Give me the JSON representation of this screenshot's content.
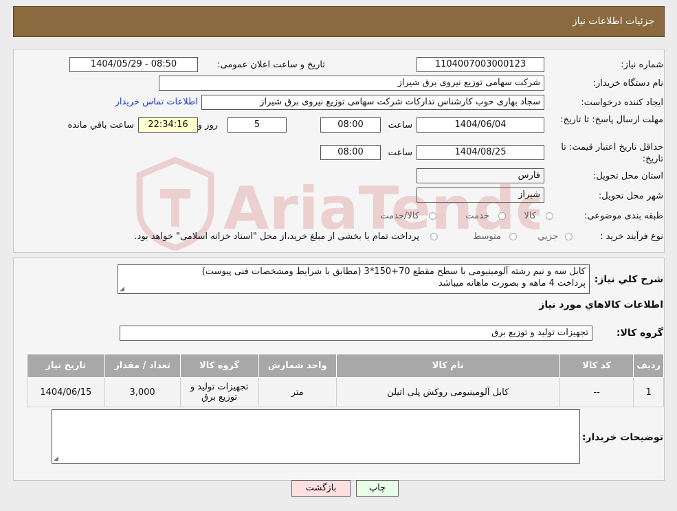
{
  "header": {
    "title": "جزئیات اطلاعات نیاز"
  },
  "form": {
    "need_number_label": "شماره نیاز:",
    "need_number": "1104007003000123",
    "announce_label": "تاریخ و ساعت اعلان عمومی:",
    "announce_value": "1404/05/29 - 08:50",
    "buyer_label": "نام دستگاه خریدار:",
    "buyer_value": "شرکت سهامی توزیع نیروی برق شیراز",
    "creator_label": "ایجاد کننده درخواست:",
    "creator_value": "سجاد بهاری خوب کارشناس تدارکات شرکت سهامی توزیع نیروی برق شیراز",
    "contact_link": "اطلاعات تماس خریدار",
    "deadline_label": "مهلت ارسال پاسخ: تا تاریخ:",
    "deadline_date": "1404/06/04",
    "time_label": "ساعت",
    "deadline_time": "08:00",
    "days_value": "5",
    "days_label": "روز و",
    "remaining_time": "22:34:16",
    "remaining_label": "ساعت باقي مانده",
    "validity_label": "حداقل تاریخ اعتبار قیمت: تا تاریخ:",
    "validity_date": "1404/08/25",
    "validity_time": "08:00",
    "province_label": "استان محل تحویل:",
    "province_value": "فارس",
    "city_label": "شهر محل تحویل:",
    "city_value": "شیراز",
    "category_label": "طبقه بندی موضوعی:",
    "category_options": [
      "کالا",
      "خدمت",
      "کالا/خدمت"
    ],
    "process_label": "نوع فرآیند خرید :",
    "process_options": [
      "جزیي",
      "متوسط"
    ],
    "process_note": "پرداخت تمام یا بخشی از مبلغ خرید،از محل \"اسناد خزانه اسلامی\" خواهد بود."
  },
  "summary": {
    "label": "شرح کلي نیاز:",
    "line1": "کابل سه و نیم رشته آلومینیومی با سطح مقطع 70+150*3 (مطابق با شرایط ومشخصات فنی پیوست)",
    "line2": "پرداخت 4 ماهه و بصورت ماهانه میباشد",
    "goods_info_title": "اطلاعات کالاهاي مورد نیاز",
    "goods_group_label": "گروه کالا:",
    "goods_group_value": "تجهیزات تولید و توزیع برق"
  },
  "table": {
    "headers": [
      "ردیف",
      "کد کالا",
      "نام کالا",
      "واحد شمارش",
      "گروه کالا",
      "تعداد / مقدار",
      "تاریخ نیاز"
    ],
    "rows": [
      [
        "1",
        "--",
        "کابل آلومینیومی روکش پلی اتیلن",
        "متر",
        "تجهیزات تولید و توزیع برق",
        "3,000",
        "1404/06/15"
      ]
    ]
  },
  "buyer_notes": {
    "label": "توضیحات خریدار:",
    "value": ""
  },
  "buttons": {
    "print": "چاپ",
    "back": "بازگشت"
  },
  "watermark": {
    "text": "AriaTender.neT"
  },
  "colors": {
    "header_bg": "#8b6a3f",
    "link": "#1a3fd0",
    "back_button_bg": "#ffe0e0",
    "print_button_bg": "#e6ffe6"
  }
}
